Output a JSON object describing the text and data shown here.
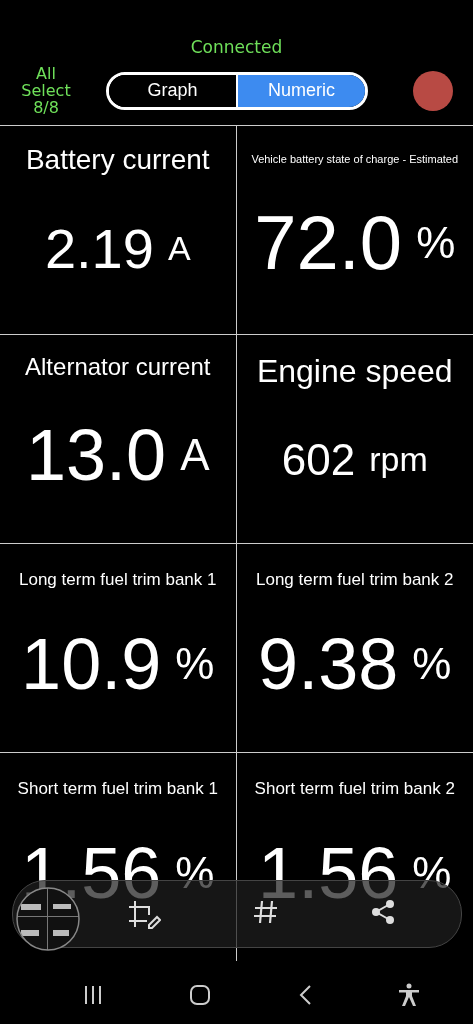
{
  "status": "Connected",
  "select_all": {
    "label": "All\nSelect\n8/8"
  },
  "view_tabs": [
    {
      "label": "Graph",
      "selected": false
    },
    {
      "label": "Numeric",
      "selected": true
    }
  ],
  "record_button": {
    "on": true
  },
  "gauges": [
    {
      "title": "Battery current",
      "value": "2.19",
      "unit": "A"
    },
    {
      "title": "Vehicle battery state of charge  -  Estimated",
      "value": "72.0",
      "unit": "%"
    },
    {
      "title": "Alternator current",
      "value": "13.0",
      "unit": "A"
    },
    {
      "title": "Engine speed",
      "value": "602",
      "unit": "rpm"
    },
    {
      "title": "Long term fuel trim bank 1",
      "value": "10.9",
      "unit": "%"
    },
    {
      "title": "Long term fuel trim bank 2",
      "value": "9.38",
      "unit": "%"
    },
    {
      "title": "Short term fuel trim bank 1",
      "value": "1.56",
      "unit": "%"
    },
    {
      "title": "Short term fuel trim bank 2",
      "value": "1.56",
      "unit": "%"
    }
  ]
}
